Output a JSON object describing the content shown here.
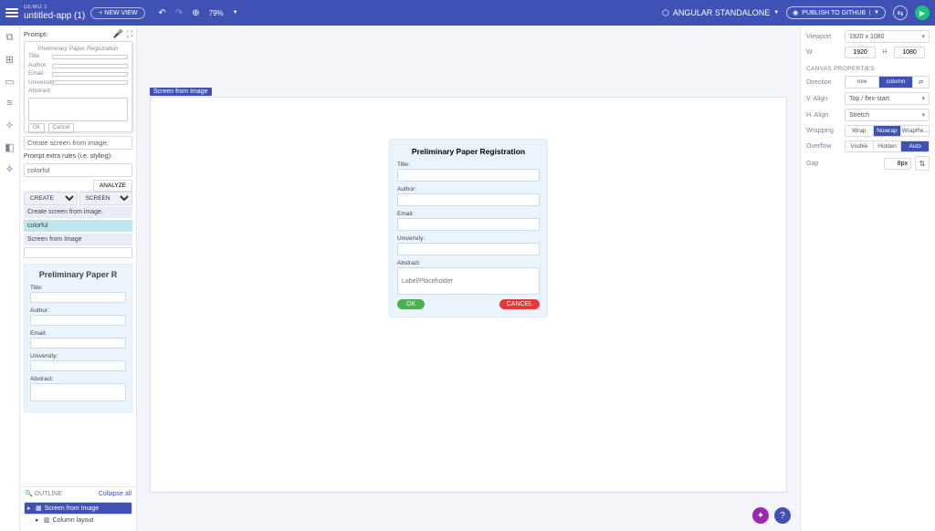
{
  "topbar": {
    "demo_label": "DEMO 1",
    "app_name": "untitled-app (1)",
    "new_view": "+ NEW VIEW",
    "zoom": "79%",
    "angular_label": "ANGULAR STANDALONE",
    "publish_label": "PUBLISH TO GITHUB"
  },
  "iconrail": {
    "items": [
      "copy-icon",
      "components-icon",
      "layers-icon",
      "data-icon",
      "code-icon",
      "plugins-icon",
      "ai-icon"
    ]
  },
  "prompt": {
    "label": "Prompt:",
    "sketch": {
      "title": "Preliminary Paper Registration",
      "fields": [
        "Title:",
        "Author:",
        "Email:",
        "University:",
        "Abstract:"
      ],
      "ok": "Ok",
      "cancel": "Cancel"
    },
    "create_screen": "Create screen from image.",
    "extra_label": "Prompt extra rules (i.e. styling):",
    "extra_value": "colorful",
    "analyze": "ANALYZE",
    "dropdown_create": "CREATE",
    "dropdown_screen": "SCREEN",
    "history": [
      "Create screen from image.",
      "colorful",
      "Screen from Image"
    ]
  },
  "preview_form": {
    "title": "Preliminary Paper R",
    "fields": [
      "Title:",
      "Author:",
      "Email:",
      "University:",
      "Abstract:"
    ]
  },
  "outline": {
    "label": "OUTLINE",
    "collapse": "Collapse all",
    "root": "Screen from Image",
    "child": "Column layout"
  },
  "canvas": {
    "tag": "Screen from Image",
    "form": {
      "title": "Preliminary Paper Registration",
      "fields": [
        "Title:",
        "Author:",
        "Email:",
        "University:",
        "Abstract:"
      ],
      "abstract_placeholder": "Label/Placeholder",
      "ok": "OK",
      "cancel": "CANCEL"
    }
  },
  "props": {
    "viewport_label": "Viewport",
    "viewport_value": "1920 x 1080",
    "w_label": "W",
    "w_value": "1920",
    "h_label": "H",
    "h_value": "1080",
    "section": "CANVAS PROPERTIES",
    "direction_label": "Direction",
    "direction_row": "row",
    "direction_col": "column",
    "valign_label": "V. Align",
    "valign_value": "Top / flex-start",
    "halign_label": "H. Align",
    "halign_value": "Stretch",
    "wrap_label": "Wrapping",
    "wrap_wrap": "Wrap",
    "wrap_nowrap": "Nowrap",
    "wrap_rev": "WrapRe...",
    "overflow_label": "Overflow",
    "ov_visible": "Visible",
    "ov_hidden": "Hidden",
    "ov_auto": "Auto",
    "gap_label": "Gap",
    "gap_value": "8px"
  }
}
